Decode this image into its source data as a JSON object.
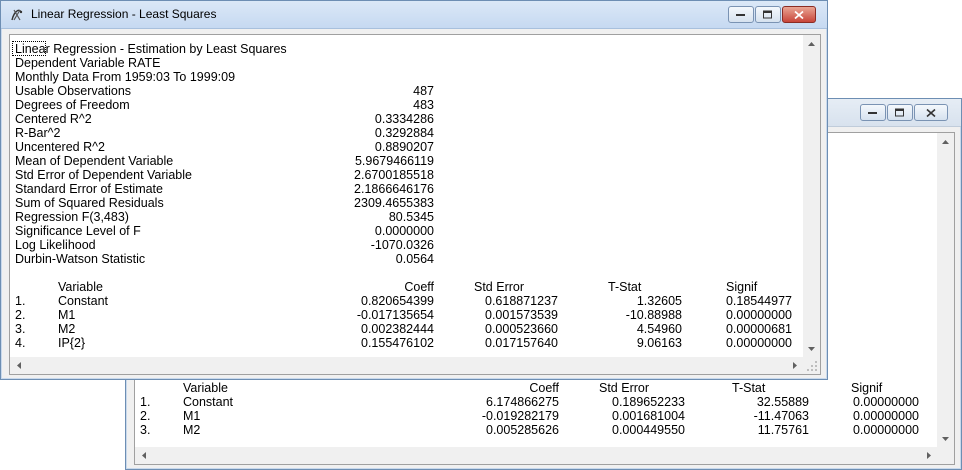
{
  "windows": {
    "front": {
      "title": "Linear Regression - Least Squares",
      "header_lines": [
        "Linear Regression - Estimation by Least Squares",
        "Dependent Variable RATE",
        "Monthly Data From 1959:03 To 1999:09"
      ],
      "stats": [
        {
          "label": "Usable Observations",
          "value": "487"
        },
        {
          "label": "Degrees of Freedom",
          "value": "483"
        },
        {
          "label": "Centered R^2",
          "value": "0.3334286"
        },
        {
          "label": "R-Bar^2",
          "value": "0.3292884"
        },
        {
          "label": "Uncentered R^2",
          "value": "0.8890207"
        },
        {
          "label": "Mean of Dependent Variable",
          "value": "5.9679466119"
        },
        {
          "label": "Std Error of Dependent Variable",
          "value": "2.6700185518"
        },
        {
          "label": "Standard Error of Estimate",
          "value": "2.1866646176"
        },
        {
          "label": "Sum of Squared Residuals",
          "value": "2309.4655383"
        },
        {
          "label": "Regression F(3,483)",
          "value": "80.5345"
        },
        {
          "label": "Significance Level of F",
          "value": "0.0000000"
        },
        {
          "label": "Log Likelihood",
          "value": "-1070.0326"
        },
        {
          "label": "Durbin-Watson Statistic",
          "value": "0.0564"
        }
      ],
      "table": {
        "headers": {
          "variable": "Variable",
          "coeff": "Coeff",
          "stderr": "Std Error",
          "tstat": "T-Stat",
          "signif": "Signif"
        },
        "rows": [
          {
            "num": "1.",
            "variable": "Constant",
            "coeff": "0.820654399",
            "stderr": "0.618871237",
            "tstat": "1.32605",
            "signif": "0.18544977"
          },
          {
            "num": "2.",
            "variable": "M1",
            "coeff": "-0.017135654",
            "stderr": "0.001573539",
            "tstat": "-10.88988",
            "signif": "0.00000000"
          },
          {
            "num": "3.",
            "variable": "M2",
            "coeff": "0.002382444",
            "stderr": "0.000523660",
            "tstat": "4.54960",
            "signif": "0.00000681"
          },
          {
            "num": "4.",
            "variable": "IP{2}",
            "coeff": "0.155476102",
            "stderr": "0.017157640",
            "tstat": "9.06163",
            "signif": "0.00000000"
          }
        ]
      }
    },
    "back": {
      "title": "",
      "table": {
        "headers": {
          "variable": "Variable",
          "coeff": "Coeff",
          "stderr": "Std Error",
          "tstat": "T-Stat",
          "signif": "Signif"
        },
        "rows": [
          {
            "num": "1.",
            "variable": "Constant",
            "coeff": "6.174866275",
            "stderr": "0.189652233",
            "tstat": "32.55889",
            "signif": "0.00000000"
          },
          {
            "num": "2.",
            "variable": "M1",
            "coeff": "-0.019282179",
            "stderr": "0.001681004",
            "tstat": "-11.47063",
            "signif": "0.00000000"
          },
          {
            "num": "3.",
            "variable": "M2",
            "coeff": "0.005285626",
            "stderr": "0.000449550",
            "tstat": "11.75761",
            "signif": "0.00000000"
          }
        ]
      }
    }
  },
  "colors": {
    "titlebar_active": "#c6d9f1",
    "close_button": "#c8453a",
    "window_border": "#6d8eb3"
  },
  "icons": {
    "app": "regression-app-icon",
    "minimize": "minimize-icon",
    "maximize": "maximize-icon",
    "close": "close-icon"
  }
}
